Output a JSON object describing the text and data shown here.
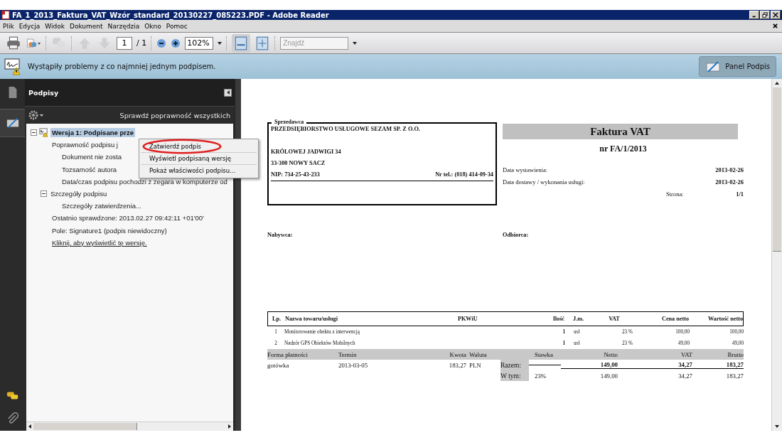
{
  "window": {
    "title": "FA_1_2013_Faktura_VAT_Wzór_standard_20130227_085223.PDF - Adobe Reader"
  },
  "menu": [
    "Plik",
    "Edycja",
    "Widok",
    "Dokument",
    "Narzędzia",
    "Okno",
    "Pomoc"
  ],
  "toolbar": {
    "page": "1",
    "page_total": "/ 1",
    "zoom": "102%",
    "search_placeholder": "Znajdź"
  },
  "notification": {
    "message": "Wystąpiły problemy z co najmniej jednym podpisem.",
    "button": "Panel Podpis"
  },
  "panel": {
    "title": "Podpisy",
    "validate_all": "Sprawdź poprawność wszystkich",
    "tree": [
      {
        "label": "Wersja 1: Podpisane prze",
        "kind": "signature",
        "expanded": true,
        "selected": true,
        "children": [
          {
            "label": "Poprawność podpisu j",
            "kind": "item",
            "selected": false,
            "children": [
              {
                "label": "Dokument nie zosta",
                "kind": "item",
                "selected": false
              },
              {
                "label": "Tozsamość autora",
                "kind": "item",
                "selected": false
              },
              {
                "label": "Data/czas podpisu pochodzi z zegara w komputerze od",
                "kind": "item",
                "selected": false
              }
            ]
          },
          {
            "label": "Szczegóły podpisu",
            "kind": "item",
            "expanded": true,
            "selected": false,
            "children": [
              {
                "label": "Szczegóły zatwierdzenia...",
                "kind": "item",
                "selected": false
              }
            ]
          },
          {
            "label": "Ostatnio sprawdzone: 2013.02.27 09:42:11 +01'00'",
            "kind": "item",
            "selected": false
          },
          {
            "label": "Pole: Signature1 (podpis niewidoczny)",
            "kind": "item",
            "selected": false
          },
          {
            "label": "Kliknij, aby wyświetlić tę wersję.",
            "kind": "link",
            "selected": false
          }
        ]
      }
    ]
  },
  "context_menu": [
    {
      "label": "Zatwierdź podpis",
      "circled": true
    },
    {
      "label": "Wyświetl podpisaną wersję",
      "circled": false
    },
    {
      "label": "Pokaż właściwości podpisu...",
      "circled": false
    }
  ],
  "invoice": {
    "seller": {
      "label": "Sprzedawca",
      "name": "PRZEDSIĘBIORSTWO USŁUGOWE SEZAM SP. Z O.O.",
      "street": "KRÓLOWEJ JADWIGI 34",
      "city": "33-300 NOWY SACZ",
      "nip": "NIP:  734-25-43-233",
      "phone": "Nr tel.: (018) 414-09-34"
    },
    "title": "Faktura VAT",
    "number": "nr FA/1/2013",
    "dates": [
      {
        "label": "Data wystawienia:",
        "value": "2013-02-26",
        "kind": "wide"
      },
      {
        "label": "Data dostawy / wykonania usługi:",
        "value": "2013-02-26",
        "kind": "wide"
      },
      {
        "label": "Strona:",
        "value": "1/1",
        "kind": "narrow"
      }
    ],
    "buyer": "Nabywca:",
    "recipient": "Odbiorca:",
    "columns": [
      "Lp.",
      "Nazwa towaru/usługi",
      "PKWiU",
      "Ilość",
      "J.m.",
      "VAT",
      "Cena netto",
      "Wartość netto"
    ],
    "rows": [
      {
        "lp": "1",
        "name": "Monitorowanie obektu z interwencją",
        "qty": "1",
        "unit": "usł",
        "vat": "23 %",
        "price": "100,00",
        "value": "100,00"
      },
      {
        "lp": "2",
        "name": "Nadzór GPS Obiektów Mobilnych",
        "qty": "1",
        "unit": "usł",
        "vat": "23 %",
        "price": "49,00",
        "value": "49,00"
      }
    ],
    "payment_columns": [
      "Forma płatności",
      "Termin",
      "Kwota",
      "Waluta"
    ],
    "payment": {
      "method": "gotówka",
      "due": "2013-03-05",
      "amount": "183,27",
      "currency": "PLN"
    },
    "summary_columns": [
      "Stawka",
      "Netto",
      "VAT",
      "Brutto"
    ],
    "summary": [
      {
        "label": "Razem:",
        "netto": "149,00",
        "vat": "34,27",
        "brutto": "183,27",
        "bold": true
      },
      {
        "label": "W tym:",
        "rate": "23%",
        "netto": "149,00",
        "vat": "34,27",
        "brutto": "183,27",
        "bold": false
      }
    ]
  }
}
